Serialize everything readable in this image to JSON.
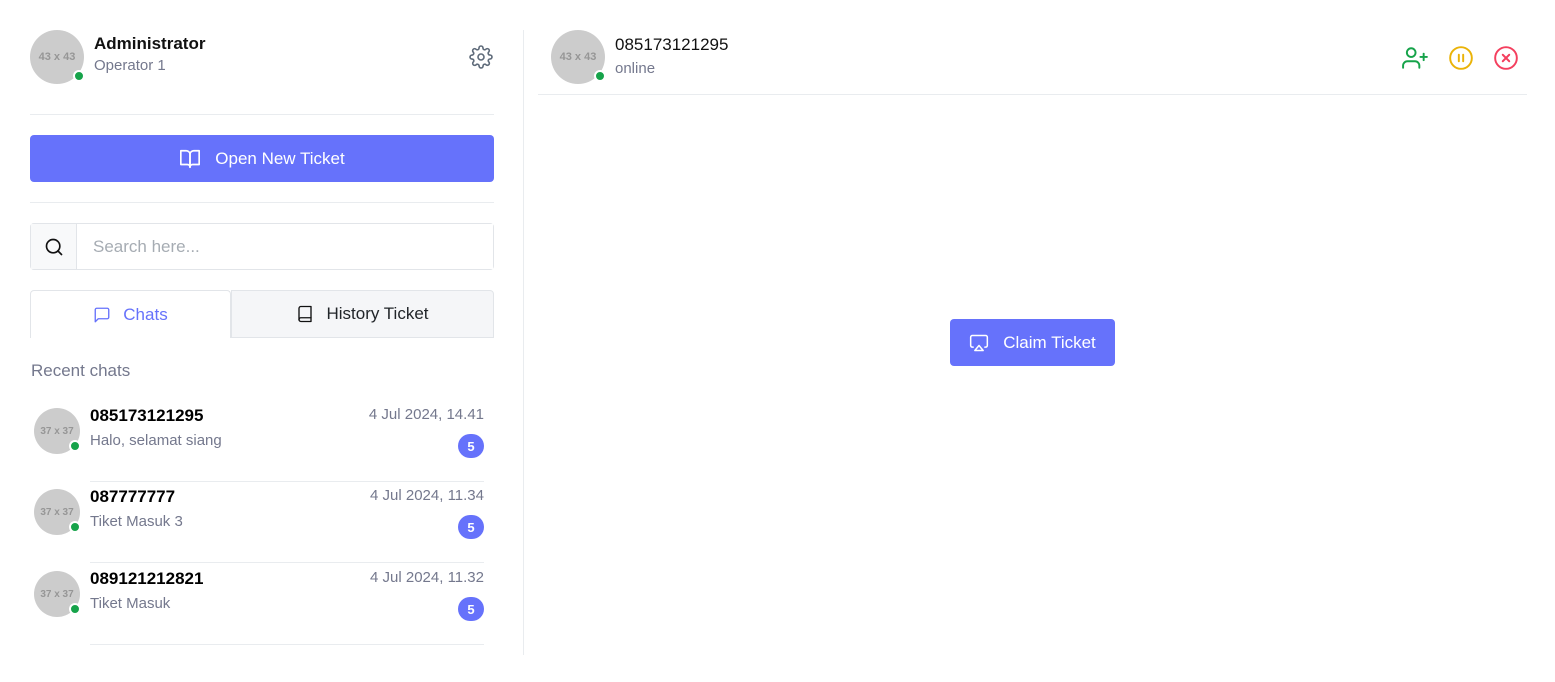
{
  "profile": {
    "avatar_text": "43 x 43",
    "name": "Administrator",
    "role": "Operator 1"
  },
  "actions": {
    "open_new_ticket": "Open New Ticket"
  },
  "search": {
    "placeholder": "Search here..."
  },
  "tabs": [
    {
      "label": "Chats",
      "active": true
    },
    {
      "label": "History Ticket",
      "active": false
    }
  ],
  "recent_chats_label": "Recent chats",
  "chats": [
    {
      "avatar_text": "37 x 37",
      "name": "085173121295",
      "message": "Halo, selamat siang",
      "time": "4 Jul 2024, 14.41",
      "unread": "5"
    },
    {
      "avatar_text": "37 x 37",
      "name": "087777777",
      "message": "Tiket Masuk 3",
      "time": "4 Jul 2024, 11.34",
      "unread": "5"
    },
    {
      "avatar_text": "37 x 37",
      "name": "089121212821",
      "message": "Tiket Masuk",
      "time": "4 Jul 2024, 11.32",
      "unread": "5"
    }
  ],
  "conversation": {
    "avatar_text": "43 x 43",
    "contact_name": "085173121295",
    "status": "online",
    "claim_label": "Claim Ticket"
  },
  "colors": {
    "primary": "#6672fb",
    "online": "#16a34a",
    "add_user": "#16a34a",
    "pause": "#eab308",
    "close": "#f43f5e"
  },
  "icons": [
    "gear-icon",
    "book-open-icon",
    "search-icon",
    "chat-bubble-icon",
    "book-icon",
    "user-plus-icon",
    "pause-circle-icon",
    "close-circle-icon",
    "airplay-icon"
  ]
}
